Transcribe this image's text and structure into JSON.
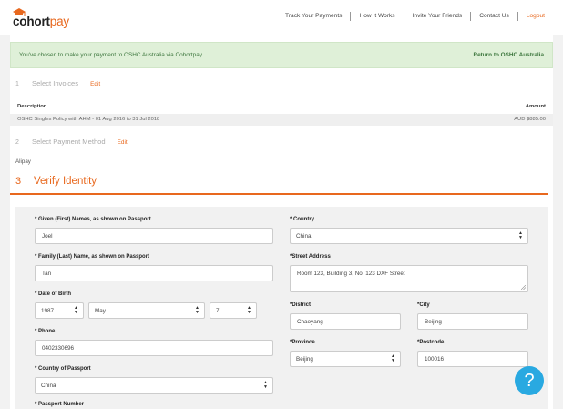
{
  "header": {
    "logo": {
      "part1": "cohort",
      "part2": "pay"
    },
    "nav": [
      {
        "label": "Track Your Payments"
      },
      {
        "label": "How It Works"
      },
      {
        "label": "Invite Your Friends"
      },
      {
        "label": "Contact Us"
      },
      {
        "label": "Logout"
      }
    ]
  },
  "banner": {
    "message": "You've chosen to make your payment to OSHC Australia via Cohortpay.",
    "link": "Return to OSHC Australia"
  },
  "step1": {
    "number": "1",
    "title": "Select Invoices",
    "edit": "Edit",
    "table": {
      "headers": {
        "description": "Description",
        "amount": "Amount"
      },
      "rows": [
        {
          "description": "OSHC Singles Policy with AHM - 01 Aug 2016 to 31 Jul 2018",
          "amount": "AUD $885.00"
        }
      ]
    }
  },
  "step2": {
    "number": "2",
    "title": "Select Payment Method",
    "edit": "Edit",
    "selected": "Alipay"
  },
  "step3": {
    "number": "3",
    "title": "Verify Identity"
  },
  "form": {
    "given_name": {
      "label": "* Given (First) Names, as shown on Passport",
      "value": "Joel"
    },
    "family_name": {
      "label": "* Family (Last) Name, as shown on Passport",
      "value": "Tan"
    },
    "dob": {
      "label": "* Date of Birth",
      "year": "1987",
      "month": "May",
      "day": "7"
    },
    "phone": {
      "label": "* Phone",
      "value": "0402330696"
    },
    "passport_country": {
      "label": "* Country of Passport",
      "value": "China"
    },
    "passport_number": {
      "label": "* Passport Number"
    },
    "country": {
      "label": "* Country",
      "value": "China"
    },
    "street": {
      "label": "*Street Address",
      "value": "Room 123, Building 3, No. 123 DXF Street"
    },
    "district": {
      "label": "*District",
      "value": "Chaoyang"
    },
    "city": {
      "label": "*City",
      "value": "Beijing"
    },
    "province": {
      "label": "*Province",
      "value": "Beijing"
    },
    "postcode": {
      "label": "*Postcode",
      "value": "100016"
    }
  },
  "help": {
    "label": "?"
  },
  "colors": {
    "accent": "#e8681e",
    "banner_bg": "#dff0d8",
    "banner_text": "#3c763d",
    "help": "#29a9e1"
  }
}
